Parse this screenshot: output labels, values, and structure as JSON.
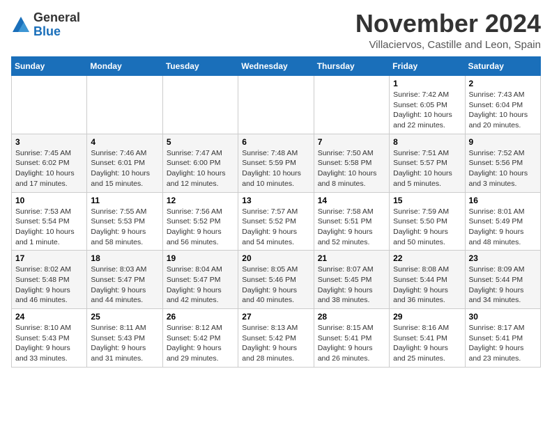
{
  "header": {
    "logo_general": "General",
    "logo_blue": "Blue",
    "month_title": "November 2024",
    "subtitle": "Villaciervos, Castille and Leon, Spain"
  },
  "days_of_week": [
    "Sunday",
    "Monday",
    "Tuesday",
    "Wednesday",
    "Thursday",
    "Friday",
    "Saturday"
  ],
  "weeks": [
    [
      {
        "day": "",
        "info": ""
      },
      {
        "day": "",
        "info": ""
      },
      {
        "day": "",
        "info": ""
      },
      {
        "day": "",
        "info": ""
      },
      {
        "day": "",
        "info": ""
      },
      {
        "day": "1",
        "info": "Sunrise: 7:42 AM\nSunset: 6:05 PM\nDaylight: 10 hours and 22 minutes."
      },
      {
        "day": "2",
        "info": "Sunrise: 7:43 AM\nSunset: 6:04 PM\nDaylight: 10 hours and 20 minutes."
      }
    ],
    [
      {
        "day": "3",
        "info": "Sunrise: 7:45 AM\nSunset: 6:02 PM\nDaylight: 10 hours and 17 minutes."
      },
      {
        "day": "4",
        "info": "Sunrise: 7:46 AM\nSunset: 6:01 PM\nDaylight: 10 hours and 15 minutes."
      },
      {
        "day": "5",
        "info": "Sunrise: 7:47 AM\nSunset: 6:00 PM\nDaylight: 10 hours and 12 minutes."
      },
      {
        "day": "6",
        "info": "Sunrise: 7:48 AM\nSunset: 5:59 PM\nDaylight: 10 hours and 10 minutes."
      },
      {
        "day": "7",
        "info": "Sunrise: 7:50 AM\nSunset: 5:58 PM\nDaylight: 10 hours and 8 minutes."
      },
      {
        "day": "8",
        "info": "Sunrise: 7:51 AM\nSunset: 5:57 PM\nDaylight: 10 hours and 5 minutes."
      },
      {
        "day": "9",
        "info": "Sunrise: 7:52 AM\nSunset: 5:56 PM\nDaylight: 10 hours and 3 minutes."
      }
    ],
    [
      {
        "day": "10",
        "info": "Sunrise: 7:53 AM\nSunset: 5:54 PM\nDaylight: 10 hours and 1 minute."
      },
      {
        "day": "11",
        "info": "Sunrise: 7:55 AM\nSunset: 5:53 PM\nDaylight: 9 hours and 58 minutes."
      },
      {
        "day": "12",
        "info": "Sunrise: 7:56 AM\nSunset: 5:52 PM\nDaylight: 9 hours and 56 minutes."
      },
      {
        "day": "13",
        "info": "Sunrise: 7:57 AM\nSunset: 5:52 PM\nDaylight: 9 hours and 54 minutes."
      },
      {
        "day": "14",
        "info": "Sunrise: 7:58 AM\nSunset: 5:51 PM\nDaylight: 9 hours and 52 minutes."
      },
      {
        "day": "15",
        "info": "Sunrise: 7:59 AM\nSunset: 5:50 PM\nDaylight: 9 hours and 50 minutes."
      },
      {
        "day": "16",
        "info": "Sunrise: 8:01 AM\nSunset: 5:49 PM\nDaylight: 9 hours and 48 minutes."
      }
    ],
    [
      {
        "day": "17",
        "info": "Sunrise: 8:02 AM\nSunset: 5:48 PM\nDaylight: 9 hours and 46 minutes."
      },
      {
        "day": "18",
        "info": "Sunrise: 8:03 AM\nSunset: 5:47 PM\nDaylight: 9 hours and 44 minutes."
      },
      {
        "day": "19",
        "info": "Sunrise: 8:04 AM\nSunset: 5:47 PM\nDaylight: 9 hours and 42 minutes."
      },
      {
        "day": "20",
        "info": "Sunrise: 8:05 AM\nSunset: 5:46 PM\nDaylight: 9 hours and 40 minutes."
      },
      {
        "day": "21",
        "info": "Sunrise: 8:07 AM\nSunset: 5:45 PM\nDaylight: 9 hours and 38 minutes."
      },
      {
        "day": "22",
        "info": "Sunrise: 8:08 AM\nSunset: 5:44 PM\nDaylight: 9 hours and 36 minutes."
      },
      {
        "day": "23",
        "info": "Sunrise: 8:09 AM\nSunset: 5:44 PM\nDaylight: 9 hours and 34 minutes."
      }
    ],
    [
      {
        "day": "24",
        "info": "Sunrise: 8:10 AM\nSunset: 5:43 PM\nDaylight: 9 hours and 33 minutes."
      },
      {
        "day": "25",
        "info": "Sunrise: 8:11 AM\nSunset: 5:43 PM\nDaylight: 9 hours and 31 minutes."
      },
      {
        "day": "26",
        "info": "Sunrise: 8:12 AM\nSunset: 5:42 PM\nDaylight: 9 hours and 29 minutes."
      },
      {
        "day": "27",
        "info": "Sunrise: 8:13 AM\nSunset: 5:42 PM\nDaylight: 9 hours and 28 minutes."
      },
      {
        "day": "28",
        "info": "Sunrise: 8:15 AM\nSunset: 5:41 PM\nDaylight: 9 hours and 26 minutes."
      },
      {
        "day": "29",
        "info": "Sunrise: 8:16 AM\nSunset: 5:41 PM\nDaylight: 9 hours and 25 minutes."
      },
      {
        "day": "30",
        "info": "Sunrise: 8:17 AM\nSunset: 5:41 PM\nDaylight: 9 hours and 23 minutes."
      }
    ]
  ]
}
